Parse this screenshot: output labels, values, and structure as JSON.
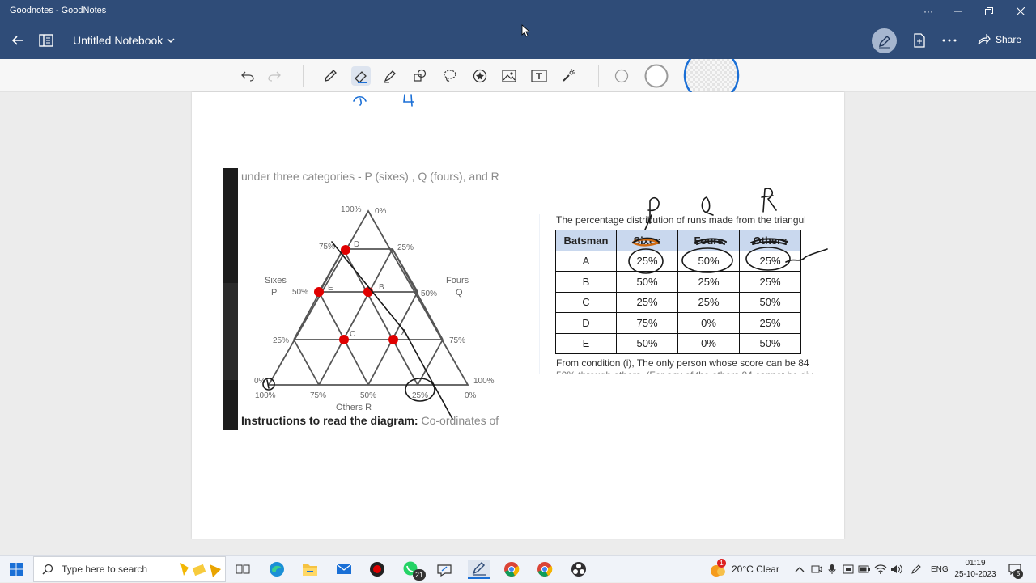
{
  "window": {
    "title": "Goodnotes - GoodNotes"
  },
  "appbar": {
    "notebook_title": "Untitled Notebook",
    "share_label": "Share"
  },
  "snippet_left": {
    "header": "under three categories - P (sixes) , Q (fours), and R",
    "footer_bold": "Instructions to read the diagram:",
    "footer_light": " Co-ordinates of",
    "diagram": {
      "top_labels": [
        "100%",
        "0%"
      ],
      "left_side_ticks": [
        "75%",
        "50%",
        "25%"
      ],
      "right_side_ticks": [
        "25%",
        "50%",
        "75%"
      ],
      "sixes_label": "Sixes",
      "sixes_letter": "P",
      "fours_label": "Fours",
      "fours_letter": "Q",
      "bottom_left_corner": [
        "0%",
        "100%"
      ],
      "bottom_right_corner": [
        "100%",
        "0%"
      ],
      "bottom_ticks": [
        "75%",
        "50%",
        "25%"
      ],
      "others_label": "Others  R",
      "point_labels": [
        "D",
        "E",
        "B",
        "C",
        "A"
      ]
    }
  },
  "snippet_right": {
    "header": "The percentage distribution of runs made from the triangul",
    "table": {
      "columns": [
        "Batsman",
        "Sixes",
        "Fours",
        "Others"
      ],
      "rows": [
        [
          "A",
          "25%",
          "50%",
          "25%"
        ],
        [
          "B",
          "50%",
          "25%",
          "25%"
        ],
        [
          "C",
          "25%",
          "25%",
          "50%"
        ],
        [
          "D",
          "75%",
          "0%",
          "25%"
        ],
        [
          "E",
          "50%",
          "0%",
          "50%"
        ]
      ]
    },
    "footer": "From condition (i), The only person whose score can be 84",
    "footer_cut": "50% through others. (For any of the others 84 cannot be div"
  },
  "handwriting": {
    "top_left": "2",
    "top_right": "4",
    "p": "P",
    "q": "Q",
    "r": "R"
  },
  "taskbar": {
    "search_placeholder": "Type here to search",
    "weather": "20°C  Clear",
    "lang": "ENG",
    "time": "01:19",
    "date": "25-10-2023",
    "whatsapp_badge": "21",
    "notification_badge": "5",
    "weather_badge": "1"
  },
  "colors": {
    "titlebar": "#2f4c78",
    "highlight_blue": "#1a6fd6",
    "table_header": "#c9d8ee",
    "dot_red": "#e00000"
  }
}
